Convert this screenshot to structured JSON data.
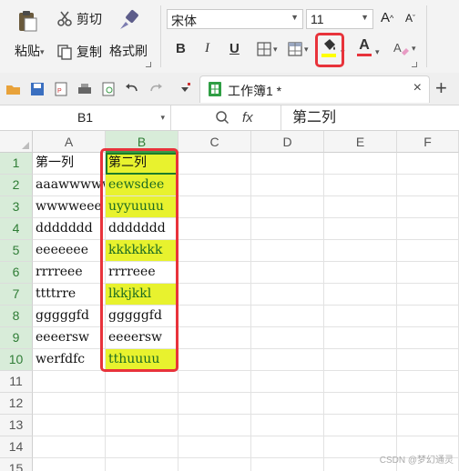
{
  "ribbon": {
    "paste_label": "粘贴",
    "cut_label": "剪切",
    "copy_label": "复制",
    "format_painter_label": "格式刷",
    "font_name": "宋体",
    "font_size": "11",
    "grow_label": "A",
    "shrink_label": "A",
    "bold_label": "B",
    "italic_label": "I",
    "underline_label": "U",
    "font_color_label": "A",
    "fill_color": "#ffff00",
    "font_color": "#e8333b",
    "highlight_box_color": "#e8333b"
  },
  "quickbar": {
    "tab_title": "工作簿1 *",
    "close_label": "×",
    "add_label": "+"
  },
  "formula_bar": {
    "name_box": "B1",
    "fx_label": "fx",
    "content": "第二列"
  },
  "grid": {
    "columns": [
      "A",
      "B",
      "C",
      "D",
      "E",
      "F"
    ],
    "rows": [
      "1",
      "2",
      "3",
      "4",
      "5",
      "6",
      "7",
      "8",
      "9",
      "10",
      "11",
      "12",
      "13",
      "14",
      "15"
    ],
    "col_a": [
      "第一列",
      "aaawwwww",
      "wwwweee",
      "ddddddd",
      "eeeeeee",
      "rrrreee",
      "ttttrre",
      "gggggfd",
      "eeeersw",
      "werfdfc"
    ],
    "col_b": [
      "第二列",
      "eewsdee",
      "uyyuuuu",
      "ddddddd",
      "kkkkkkk",
      "rrrreee",
      "lkkjkkl",
      "gggggfd",
      "eeeersw",
      "tthuuuu"
    ],
    "highlight_color": "#e8f22e",
    "selection_color": "#d8ecd9"
  },
  "watermark": "CSDN @梦幻通灵"
}
